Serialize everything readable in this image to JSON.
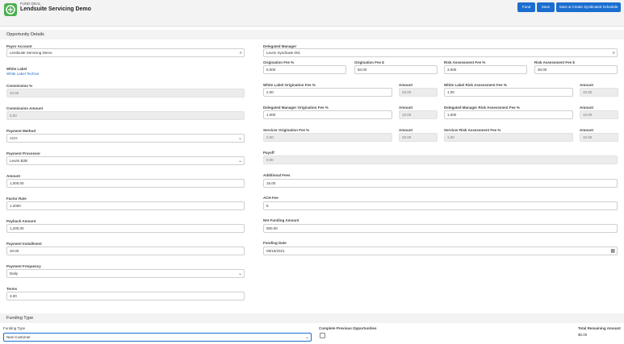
{
  "header": {
    "object_type": "FUND DEAL",
    "title": "Lendsuite Servicing Demo",
    "buttons": [
      "Fund",
      "Save",
      "Save & Create Syndicated Schedule"
    ]
  },
  "sections": {
    "opportunity_details": "Opportunity Details",
    "funding_type": "Funding Type"
  },
  "left": {
    "payor_account": {
      "label": "Payor Account",
      "value": "Lendsuite Servicing Demo"
    },
    "white_label": {
      "label": "White Label",
      "value": "White Label Techiva"
    },
    "commission_pct": {
      "label": "Commission %",
      "value": "10.00"
    },
    "commission_amount": {
      "label": "Commission Amount",
      "value": "0.00"
    },
    "payment_method": {
      "label": "Payment Method",
      "value": "ACH"
    },
    "payment_processor": {
      "label": "Payment Processor",
      "value": "Leumi B2B"
    },
    "amount": {
      "label": "Amount",
      "value": "1,000.00"
    },
    "factor_rate": {
      "label": "Factor Rate",
      "value": "1.2000"
    },
    "payback_amount": {
      "label": "Payback Amount",
      "value": "1,200.00"
    },
    "payment_installment": {
      "label": "Payment Installment",
      "value": "20.00"
    },
    "payment_frequency": {
      "label": "Payment Frequency",
      "value": "Daily"
    },
    "terms": {
      "label": "Terms",
      "value": "3.00"
    }
  },
  "right": {
    "delegated_manager": {
      "label": "Delegated Manager",
      "value": "Leumi Syndicate 001"
    },
    "origination_fee_pct": {
      "label": "Origination Fee %",
      "value": "5.000"
    },
    "origination_fee_amt": {
      "label": "Origination Fee $",
      "value": "50.00"
    },
    "risk_fee_pct": {
      "label": "Risk Assessment Fee %",
      "value": "3.000"
    },
    "risk_fee_amt": {
      "label": "Risk Assessment Fee $",
      "value": "30.00"
    },
    "wl_orig_fee": {
      "label": "White Label Origination Fee %",
      "value": "2.00",
      "amount_label": "Amount",
      "amount": "20.00"
    },
    "wl_risk_fee": {
      "label": "White Label Risk Assessment Fee %",
      "value": "1.00",
      "amount_label": "Amount",
      "amount": "10.00"
    },
    "dm_orig_fee": {
      "label": "Delegated Manager Origination Fee %",
      "value": "1.000",
      "amount_label": "Amount",
      "amount": "10.00"
    },
    "dm_risk_fee": {
      "label": "Delegated Manager Risk Assessment Fee %",
      "value": "1.000",
      "amount_label": "Amount",
      "amount": "10.00"
    },
    "servicer_orig_fee": {
      "label": "Servicer Origination Fee %",
      "value": "2.00",
      "amount_label": "Amount",
      "amount": "20.00"
    },
    "servicer_risk_fee": {
      "label": "Servicer Risk Assessment Fee %",
      "value": "1.00",
      "amount_label": "Amount",
      "amount": "10.00"
    },
    "payoff": {
      "label": "Payoff",
      "value": "0.00"
    },
    "additional_fees": {
      "label": "Additional Fees",
      "value": "15.00"
    },
    "ach_fee": {
      "label": "ACH Fee",
      "value": "5"
    },
    "net_funding_amount": {
      "label": "Net Funding Amount",
      "value": "900.00"
    },
    "funding_date": {
      "label": "Funding Date",
      "value": "09/16/2021"
    }
  },
  "funding": {
    "type_label": "Funding Type",
    "type_value": "New Customer",
    "complete_prev_label": "Complete Previous Opportunities",
    "total_remaining_label": "Total Remaining Amount",
    "total_remaining_value": "$0.00"
  }
}
